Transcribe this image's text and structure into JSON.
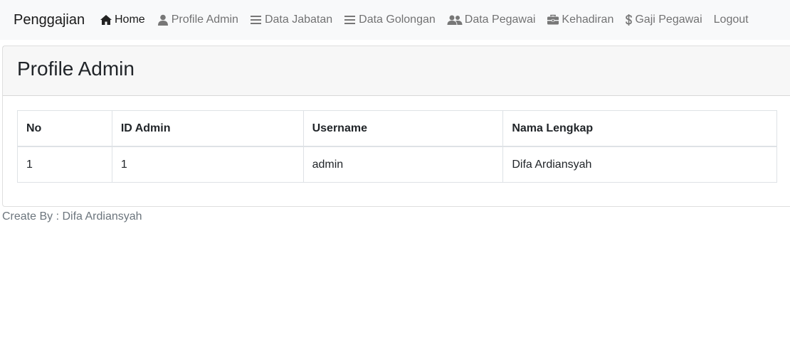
{
  "navbar": {
    "brand": "Penggajian",
    "items": [
      {
        "label": "Home",
        "icon": "home-icon",
        "active": true
      },
      {
        "label": "Profile Admin",
        "icon": "user-icon",
        "active": false
      },
      {
        "label": "Data Jabatan",
        "icon": "list-icon",
        "active": false
      },
      {
        "label": "Data Golongan",
        "icon": "list-icon",
        "active": false
      },
      {
        "label": "Data Pegawai",
        "icon": "users-icon",
        "active": false
      },
      {
        "label": "Kehadiran",
        "icon": "briefcase-icon",
        "active": false
      },
      {
        "label": "Gaji Pegawai",
        "icon": "dollar-icon",
        "active": false
      },
      {
        "label": "Logout",
        "icon": "",
        "active": false
      }
    ]
  },
  "card": {
    "title": "Profile Admin"
  },
  "table": {
    "headers": [
      "No",
      "ID Admin",
      "Username",
      "Nama Lengkap"
    ],
    "rows": [
      [
        "1",
        "1",
        "admin",
        "Difa Ardiansyah"
      ]
    ]
  },
  "footer": {
    "text": "Create By : Difa Ardiansyah"
  }
}
